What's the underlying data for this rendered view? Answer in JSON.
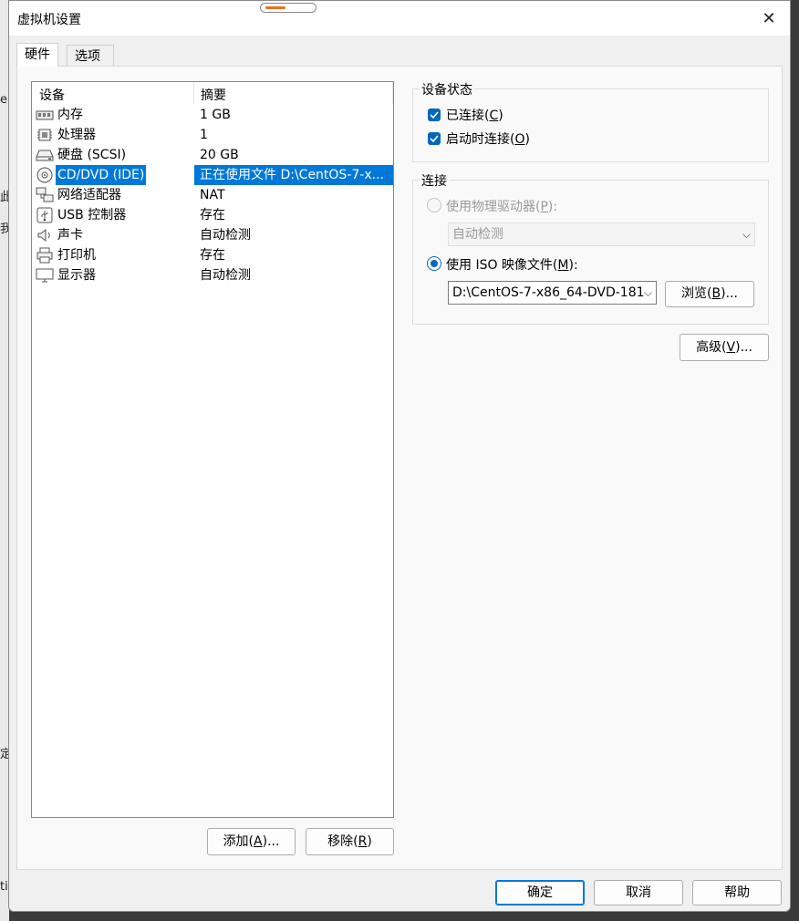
{
  "window": {
    "title": "虚拟机设置",
    "close_glyph": "✕"
  },
  "background_fragments": [
    "er",
    "此",
    "我",
    "定",
    "ti"
  ],
  "tabs": [
    {
      "label": "硬件",
      "active": true
    },
    {
      "label": "选项",
      "active": false
    }
  ],
  "device_list": {
    "columns": [
      "设备",
      "摘要"
    ],
    "selected_index": 3,
    "rows": [
      {
        "name": "内存",
        "summary": "1 GB",
        "icon": "memory-icon"
      },
      {
        "name": "处理器",
        "summary": "1",
        "icon": "processor-icon"
      },
      {
        "name": "硬盘 (SCSI)",
        "summary": "20 GB",
        "icon": "harddisk-icon"
      },
      {
        "name": "CD/DVD (IDE)",
        "summary": "正在使用文件 D:\\CentOS-7-x...",
        "icon": "cd-dvd-icon"
      },
      {
        "name": "网络适配器",
        "summary": "NAT",
        "icon": "network-adapter-icon"
      },
      {
        "name": "USB 控制器",
        "summary": "存在",
        "icon": "usb-icon"
      },
      {
        "name": "声卡",
        "summary": "自动检测",
        "icon": "sound-icon"
      },
      {
        "name": "打印机",
        "summary": "存在",
        "icon": "printer-icon"
      },
      {
        "name": "显示器",
        "summary": "自动检测",
        "icon": "display-icon"
      }
    ]
  },
  "list_buttons": {
    "add": {
      "text": "添加(",
      "key": "A",
      "suffix": ")..."
    },
    "remove": {
      "text": "移除(",
      "key": "R",
      "suffix": ")"
    }
  },
  "device_status": {
    "title": "设备状态",
    "connected": {
      "text": "已连接(",
      "key": "C",
      "suffix": ")",
      "checked": true
    },
    "connect_on_poweron": {
      "text": "启动时连接(",
      "key": "O",
      "suffix": ")",
      "checked": true
    }
  },
  "connection": {
    "title": "连接",
    "physical_drive": {
      "text": "使用物理驱动器(",
      "key": "P",
      "suffix": "):",
      "selected": false,
      "enabled": false
    },
    "physical_drive_value": "自动检测",
    "iso_image": {
      "text": "使用 ISO 映像文件(",
      "key": "M",
      "suffix": "):",
      "selected": true
    },
    "iso_path": "D:\\CentOS-7-x86_64-DVD-181",
    "browse": {
      "text": "浏览(",
      "key": "B",
      "suffix": ")..."
    }
  },
  "advanced": {
    "text": "高级(",
    "key": "V",
    "suffix": ")..."
  },
  "footer": {
    "ok": "确定",
    "cancel": "取消",
    "help": "帮助"
  },
  "colors": {
    "selection": "#0078d7",
    "accent": "#0067c0"
  }
}
